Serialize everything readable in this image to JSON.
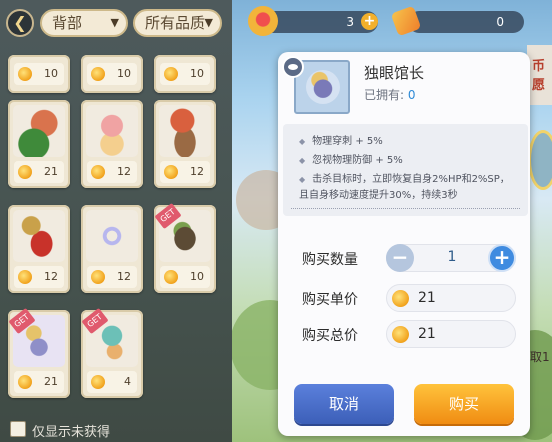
{
  "filters": {
    "slot": "背部",
    "quality": "所有品质"
  },
  "currency": {
    "first": {
      "value": "3"
    },
    "second": {
      "value": "0"
    }
  },
  "shop_items": [
    {
      "price": "10"
    },
    {
      "price": "10"
    },
    {
      "price": "10"
    },
    {
      "price": "21"
    },
    {
      "price": "12"
    },
    {
      "price": "12"
    },
    {
      "price": "12"
    },
    {
      "price": "12"
    },
    {
      "price": "10",
      "tag": "GET"
    },
    {
      "price": "21",
      "tag": "GET"
    },
    {
      "price": "4",
      "tag": "GET"
    }
  ],
  "footer": {
    "hide_unobtained_label": "仅显示未获得"
  },
  "dialog": {
    "item_name": "独眼馆长",
    "owned_label": "已拥有:",
    "owned_count": "0",
    "effects": [
      "物理穿刺 + 5%",
      "忽视物理防御 + 5%",
      "击杀目标时，立即恢复自身2%HP和2%SP，且自身移动速度提升30%，持续3秒"
    ],
    "quantity_label": "购买数量",
    "quantity_value": "1",
    "unit_price_label": "购买单价",
    "unit_price_value": "21",
    "total_price_label": "购买总价",
    "total_price_value": "21",
    "cancel_label": "取消",
    "buy_label": "购买"
  },
  "edge_text": {
    "top": "币愿",
    "bottom": "取1"
  },
  "colors": {
    "cancel": "#3c5fb8",
    "buy": "#f08c12",
    "accent_blue": "#3f8be0"
  }
}
